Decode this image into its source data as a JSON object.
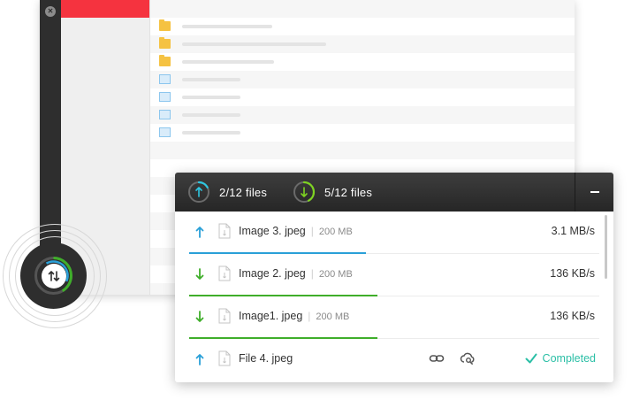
{
  "transfer": {
    "uploads": {
      "count": "2",
      "total": "/12 files",
      "progress": 0.17
    },
    "downloads": {
      "count": "5",
      "total": "/12 files",
      "progress": 0.42
    }
  },
  "files": [
    {
      "direction": "upload",
      "name": "Image 3. jpeg",
      "size": "200 MB",
      "speed": "3.1 MB/s",
      "progress": 0.43
    },
    {
      "direction": "download",
      "name": "Image 2. jpeg",
      "size": "200 MB",
      "speed": "136  KB/s",
      "progress": 0.46
    },
    {
      "direction": "download",
      "name": "Image1. jpeg",
      "size": "200 MB",
      "speed": "136  KB/s",
      "progress": 0.46
    },
    {
      "direction": "upload",
      "name": "File 4. jpeg",
      "status": "Completed"
    }
  ],
  "colors": {
    "upload": "#2aa0d8",
    "download": "#3fae2a",
    "completed": "#2bbfa6",
    "brand_red": "#f5333f",
    "header_dark": "#2e2e2e"
  },
  "icons": {
    "upload": "arrow-up-icon",
    "download": "arrow-down-icon",
    "file": "document-icon",
    "link": "link-icon",
    "share": "cloud-share-icon",
    "completed": "checkmark-icon",
    "collapse": "minus-icon",
    "transfer": "swap-arrows-icon"
  }
}
